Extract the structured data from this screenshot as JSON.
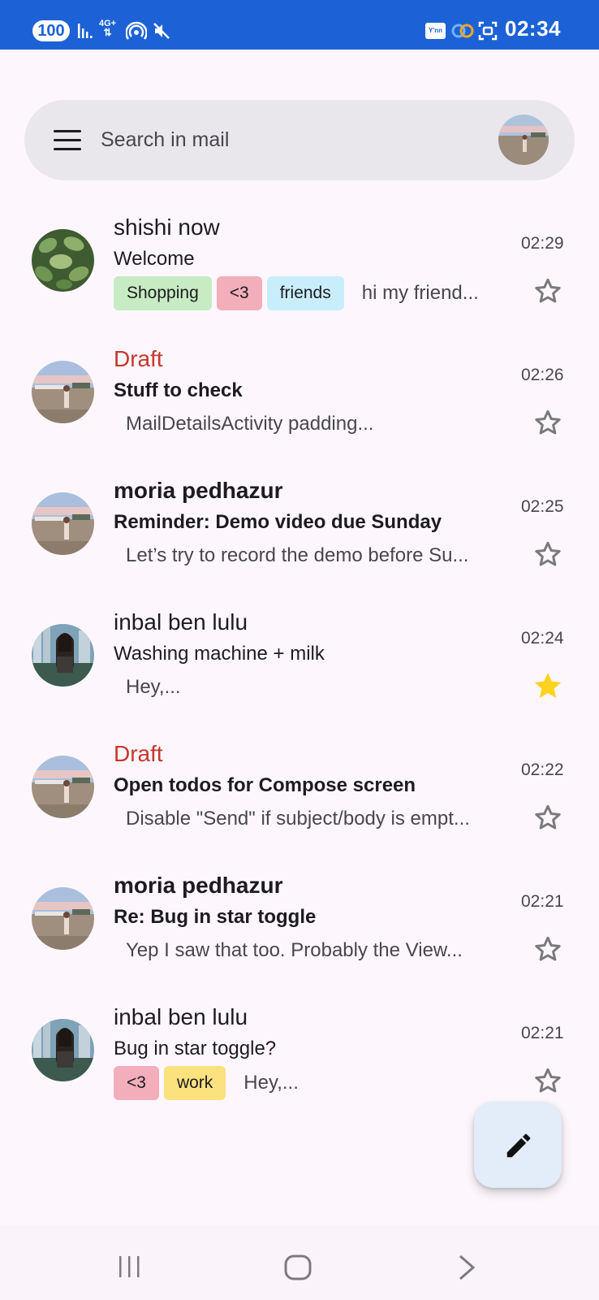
{
  "status_bar": {
    "battery": "100",
    "network": "4G+",
    "time": "02:34",
    "app_badge": "Y'nn"
  },
  "search": {
    "placeholder": "Search in mail"
  },
  "emails": [
    {
      "sender": "shishi now",
      "sender_style": "normal",
      "subject": "Welcome",
      "subject_bold": false,
      "tags": [
        {
          "label": "Shopping",
          "color": "#C7EBC2"
        },
        {
          "label": "<3",
          "color": "#F3AEBB"
        },
        {
          "label": "friends",
          "color": "#C9EEFB"
        }
      ],
      "snippet": "hi my friend...",
      "time": "02:29",
      "starred": false,
      "avatar": "leaves-avatar"
    },
    {
      "sender": "Draft",
      "sender_style": "draft",
      "subject": "Stuff to check",
      "subject_bold": true,
      "tags": [],
      "snippet": "MailDetailsActivity padding...",
      "time": "02:26",
      "starred": false,
      "avatar": "beach-avatar"
    },
    {
      "sender": "moria pedhazur",
      "sender_style": "bold",
      "subject": "Reminder: Demo video due Sunday",
      "subject_bold": true,
      "tags": [],
      "snippet": "Let’s try to record the demo before Su...",
      "time": "02:25",
      "starred": false,
      "avatar": "beach-avatar"
    },
    {
      "sender": "inbal ben lulu",
      "sender_style": "normal",
      "subject": "Washing machine + milk",
      "subject_bold": false,
      "tags": [],
      "snippet": "Hey,...",
      "time": "02:24",
      "starred": true,
      "avatar": "city-avatar"
    },
    {
      "sender": "Draft",
      "sender_style": "draft",
      "subject": "Open todos for Compose screen",
      "subject_bold": true,
      "tags": [],
      "snippet": "Disable \"Send\" if subject/body is empt...",
      "time": "02:22",
      "starred": false,
      "avatar": "beach-avatar"
    },
    {
      "sender": "moria pedhazur",
      "sender_style": "bold",
      "subject": "Re: Bug in star toggle",
      "subject_bold": true,
      "tags": [],
      "snippet": "Yep I saw that too. Probably the View...",
      "time": "02:21",
      "starred": false,
      "avatar": "beach-avatar"
    },
    {
      "sender": "inbal ben lulu",
      "sender_style": "normal",
      "subject": "Bug in star toggle?",
      "subject_bold": false,
      "tags": [
        {
          "label": "<3",
          "color": "#F3AEBB"
        },
        {
          "label": "work",
          "color": "#FBE27E"
        }
      ],
      "snippet": "Hey,...",
      "time": "02:21",
      "starred": false,
      "avatar": "city-avatar"
    }
  ],
  "fab": {
    "icon": "pencil-icon"
  },
  "colors": {
    "status_bar": "#1C62D6",
    "draft": "#C5372C",
    "star_filled": "#FFD21F",
    "star_empty": "#7A7A7A"
  }
}
